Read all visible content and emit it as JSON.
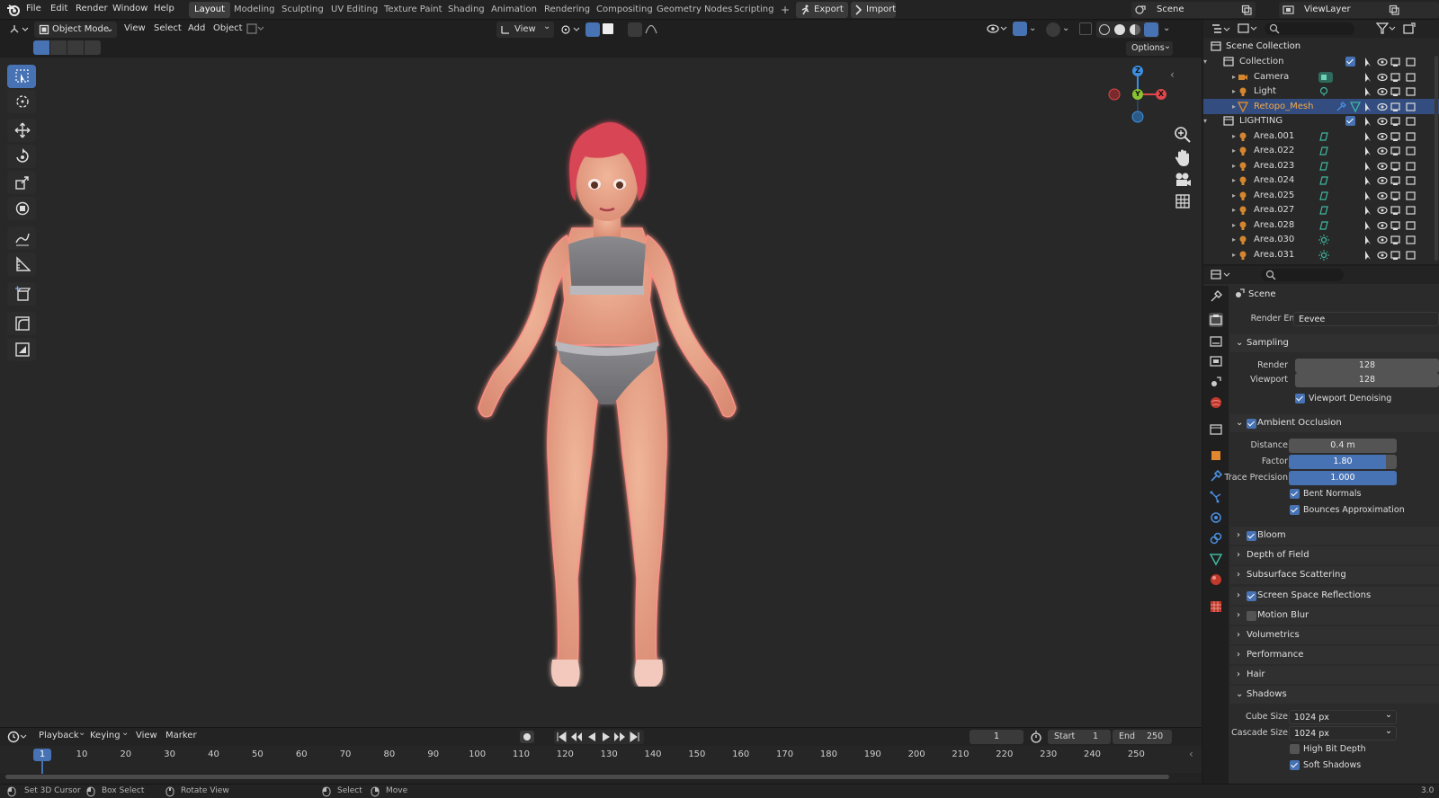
{
  "menubar": {
    "items": [
      "File",
      "Edit",
      "Render",
      "Window",
      "Help"
    ],
    "workspaces": [
      "Layout",
      "Modeling",
      "Sculpting",
      "UV Editing",
      "Texture Paint",
      "Shading",
      "Animation",
      "Rendering",
      "Compositing",
      "Geometry Nodes",
      "Scripting"
    ],
    "active_workspace": "Layout",
    "add_workspace": "+",
    "export_label": "Export",
    "import_label": "Import",
    "scene_name": "Scene",
    "view_layer": "ViewLayer"
  },
  "viewport_header": {
    "mode": "Object Mode",
    "menus": [
      "View",
      "Select",
      "Add",
      "Object"
    ],
    "orientation": "View",
    "options_label": "Options"
  },
  "gizmo": {
    "z": "Z",
    "y": "Y",
    "x": "X"
  },
  "outliner": {
    "root": "Scene Collection",
    "rows": [
      {
        "name": "Collection",
        "type": "collection"
      },
      {
        "name": "Camera",
        "type": "camera"
      },
      {
        "name": "Light",
        "type": "light"
      },
      {
        "name": "Retopo_Mesh",
        "type": "mesh",
        "selected": true
      },
      {
        "name": "LIGHTING",
        "type": "collection"
      },
      {
        "name": "Area.001",
        "type": "light"
      },
      {
        "name": "Area.022",
        "type": "light"
      },
      {
        "name": "Area.023",
        "type": "light"
      },
      {
        "name": "Area.024",
        "type": "light"
      },
      {
        "name": "Area.025",
        "type": "light"
      },
      {
        "name": "Area.027",
        "type": "light"
      },
      {
        "name": "Area.028",
        "type": "light"
      },
      {
        "name": "Area.030",
        "type": "light"
      },
      {
        "name": "Area.031",
        "type": "light"
      }
    ]
  },
  "properties": {
    "context": "Scene",
    "render_engine_label": "Render Engine",
    "render_engine": "Eevee",
    "sampling": {
      "title": "Sampling",
      "render_label": "Render",
      "render": "128",
      "viewport_label": "Viewport",
      "viewport": "128",
      "denoise_label": "Viewport Denoising"
    },
    "ao": {
      "title": "Ambient Occlusion",
      "distance_label": "Distance",
      "distance": "0.4 m",
      "factor_label": "Factor",
      "factor": "1.80",
      "factor_fill": 0.9,
      "precision_label": "Trace Precision",
      "precision": "1.000",
      "precision_fill": 1.0,
      "bent_label": "Bent Normals",
      "bounces_label": "Bounces Approximation"
    },
    "panels": [
      {
        "label": "Bloom",
        "checkbox": true,
        "checked": true
      },
      {
        "label": "Depth of Field",
        "checkbox": false
      },
      {
        "label": "Subsurface Scattering",
        "checkbox": false
      },
      {
        "label": "Screen Space Reflections",
        "checkbox": true,
        "checked": true
      },
      {
        "label": "Motion Blur",
        "checkbox": true,
        "checked": false
      },
      {
        "label": "Volumetrics",
        "checkbox": false
      },
      {
        "label": "Performance",
        "checkbox": false
      },
      {
        "label": "Hair",
        "checkbox": false
      }
    ],
    "shadows": {
      "title": "Shadows",
      "cube_label": "Cube Size",
      "cube": "1024 px",
      "cascade_label": "Cascade Size",
      "cascade": "1024 px",
      "highbit_label": "High Bit Depth",
      "soft_label": "Soft Shadows"
    }
  },
  "timeline": {
    "menus": [
      "Playback",
      "Keying",
      "View",
      "Marker"
    ],
    "current_frame": "1",
    "start_label": "Start",
    "start": "1",
    "end_label": "End",
    "end": "250",
    "ticks": [
      "1",
      "10",
      "20",
      "30",
      "40",
      "50",
      "60",
      "70",
      "80",
      "90",
      "100",
      "110",
      "120",
      "130",
      "140",
      "150",
      "160",
      "170",
      "180",
      "190",
      "200",
      "210",
      "220",
      "230",
      "240",
      "250"
    ]
  },
  "statusbar": {
    "items": [
      "Set 3D Cursor",
      "Box Select",
      "Rotate View",
      "Select",
      "Move"
    ],
    "version": "3.0"
  },
  "colors": {
    "accent": "#4772b3",
    "selected_row": "#334d80",
    "x_axis": "#e0474b",
    "y_axis": "#8ac331",
    "z_axis": "#3d8fe0",
    "light_icon": "#d4862f",
    "data_icon": "#3fb8a0"
  }
}
